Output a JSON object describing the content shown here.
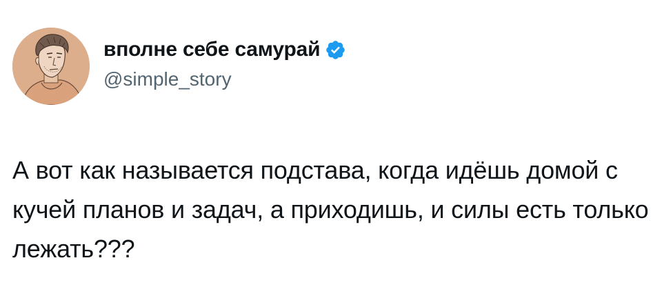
{
  "author": {
    "display_name": "вполне себе самурай",
    "handle": "@simple_story",
    "verified": true,
    "avatar_icon": "avatar-illustration-icon",
    "verified_icon": "verified-badge-icon"
  },
  "tweet": {
    "text": "А вот как называется подстава, когда идёшь домой с кучей планов и задач, а приходишь, и силы есть только лежать???"
  },
  "colors": {
    "text_primary": "#0f1419",
    "text_secondary": "#536471",
    "verified_blue": "#1d9bf0",
    "avatar_bg": "#dcae8c",
    "background": "#ffffff"
  }
}
